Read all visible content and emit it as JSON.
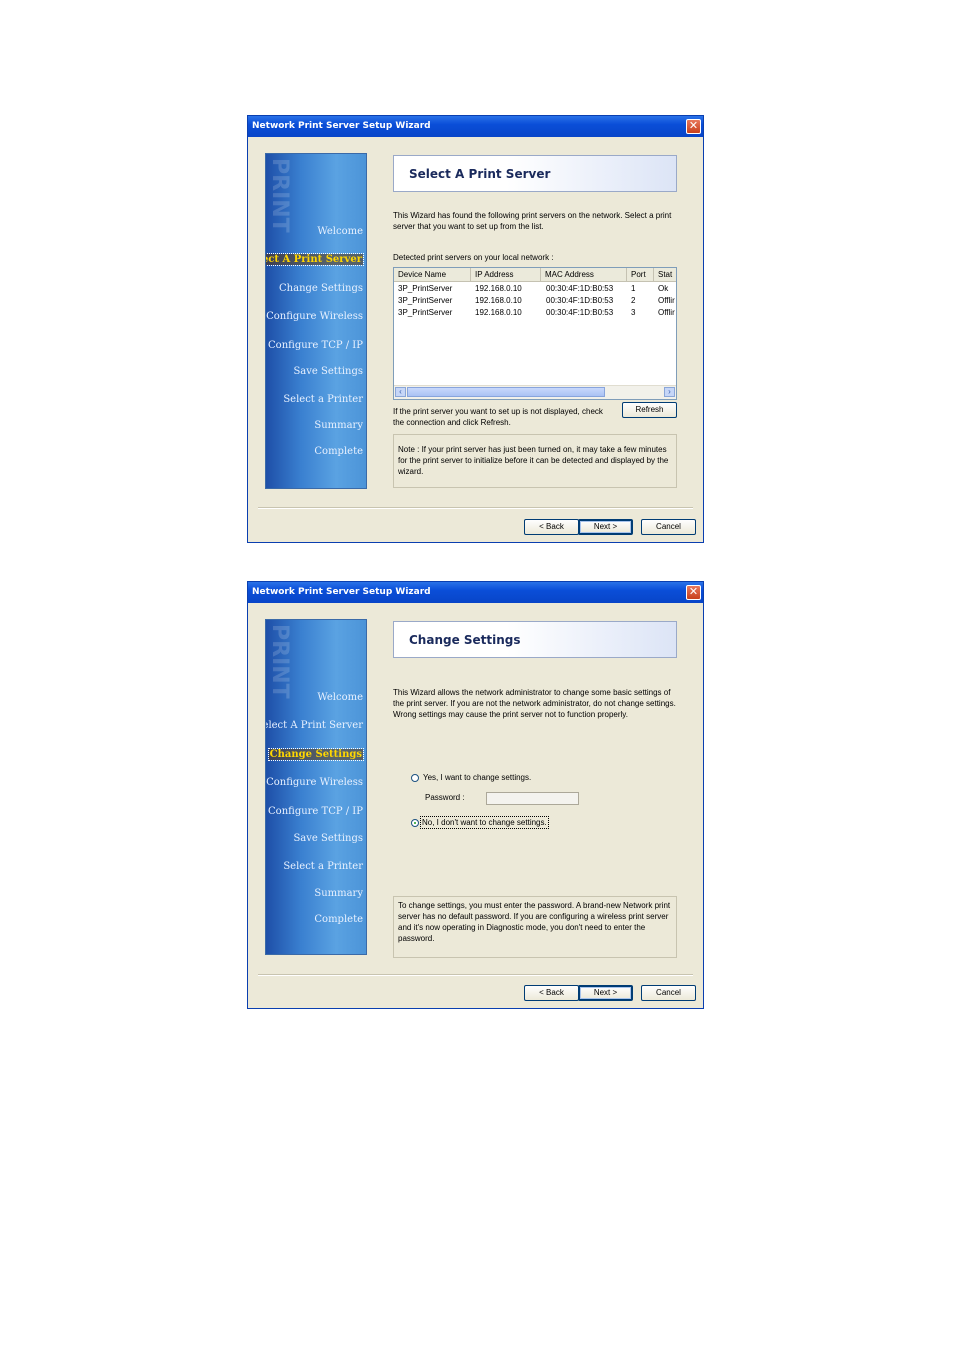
{
  "window1": {
    "title": "Network Print Server Setup Wizard",
    "close_glyph": "✕",
    "sidebar": {
      "deco": "PRINT",
      "items": [
        "Welcome",
        "Select A Print Server",
        "Change Settings",
        "Configure Wireless",
        "Configure TCP / IP",
        "Save Settings",
        "Select a Printer",
        "Summary",
        "Complete"
      ],
      "active": "Select A Print Server"
    },
    "header": "Select A Print Server",
    "intro": "This Wizard has found the following print servers on the network. Select a print server that you want to set up from the list.",
    "detected_label": "Detected print servers on your local network :",
    "table": {
      "columns": [
        "Device Name",
        "IP Address",
        "MAC Address",
        "Port",
        "Stat"
      ],
      "rows": [
        [
          "3P_PrintServer",
          "192.168.0.10",
          "00:30:4F:1D:B0:53",
          "1",
          "Ok"
        ],
        [
          "3P_PrintServer",
          "192.168.0.10",
          "00:30:4F:1D:B0:53",
          "2",
          "Offlir"
        ],
        [
          "3P_PrintServer",
          "192.168.0.10",
          "00:30:4F:1D:B0:53",
          "3",
          "Offlir"
        ]
      ]
    },
    "refresh_hint": "If the print server you want to set up is not displayed, check the connection and click Refresh.",
    "refresh_button": "Refresh",
    "note": "Note : If your print server has just been turned on, it may take a few minutes for the print server to initialize before it can be detected and displayed by the wizard.",
    "buttons": {
      "back": "< Back",
      "next": "Next >",
      "cancel": "Cancel"
    }
  },
  "window2": {
    "title": "Network Print Server Setup Wizard",
    "close_glyph": "✕",
    "sidebar": {
      "deco": "PRINT",
      "items": [
        "Welcome",
        "Select A Print Server",
        "Change Settings",
        "Configure Wireless",
        "Configure TCP / IP",
        "Save Settings",
        "Select a Printer",
        "Summary",
        "Complete"
      ],
      "active": "Change Settings"
    },
    "header": "Change Settings",
    "intro": "This Wizard allows the network administrator to change some basic settings of the print server. If you are not the network administrator, do not change settings. Wrong settings may cause the print server not to function properly.",
    "option_yes": "Yes, I want to change settings.",
    "password_label": "Password :",
    "password_value": "",
    "option_no": "No, I don't want to change settings.",
    "selected_option": "no",
    "info": "To change settings, you must enter the password. A brand-new Network print server has no default password. If you are configuring a wireless print server and it's now operating in Diagnostic mode, you don't need to enter the password.",
    "buttons": {
      "back": "< Back",
      "next": "Next >",
      "cancel": "Cancel"
    }
  }
}
